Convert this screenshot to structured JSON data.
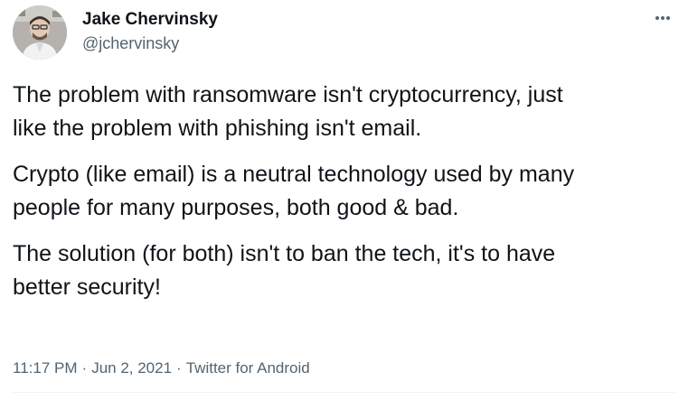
{
  "author": {
    "display_name": "Jake Chervinsky",
    "handle": "@jchervinsky"
  },
  "menu": {
    "icon": "more-horizontal-icon"
  },
  "tweet": {
    "paragraphs": [
      "The problem with ransomware isn't cryptocurrency, just\nlike the problem with phishing isn't email.",
      "Crypto (like email) is a neutral technology used by many\npeople for many purposes, both good & bad.",
      "The solution (for both) isn't to ban the tech, it's to have\nbetter security!"
    ]
  },
  "meta": {
    "time": "11:17 PM",
    "date": "Jun 2, 2021",
    "source": "Twitter for Android",
    "separator": "·"
  },
  "colors": {
    "text_primary": "#0f1419",
    "text_secondary": "#536471"
  }
}
